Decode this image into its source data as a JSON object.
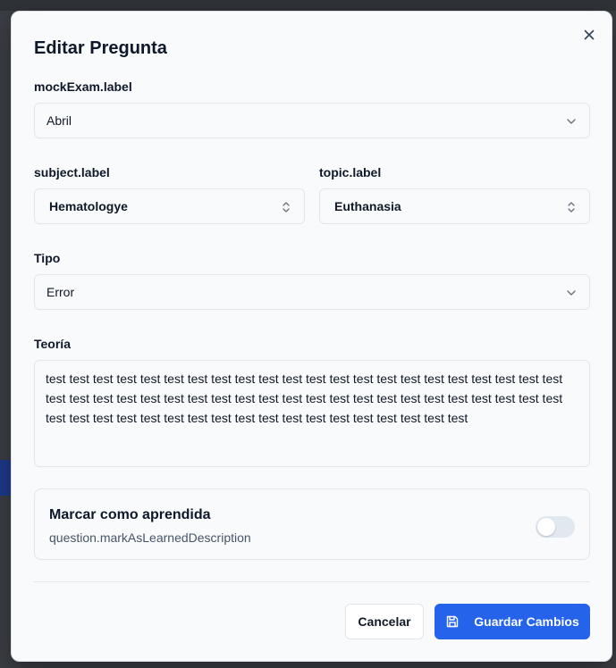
{
  "dialog": {
    "title": "Editar Pregunta",
    "close_icon": "close-icon"
  },
  "mock_exam": {
    "label": "mockExam.label",
    "value": "Abril"
  },
  "subject": {
    "label": "subject.label",
    "value": "Hematologye"
  },
  "topic": {
    "label": "topic.label",
    "value": "Euthanasia"
  },
  "type": {
    "label": "Tipo",
    "value": "Error"
  },
  "theory": {
    "label": "Teoría",
    "value": " test test test test test test test test test test test test test test test test test test test test test test test test test test test test test test test test test test test test test test test test test test test test test test test test test test test test test test test test test test test test test test"
  },
  "learned": {
    "title": "Marcar como aprendida",
    "description": "question.markAsLearnedDescription",
    "checked": false
  },
  "footer": {
    "cancel_label": "Cancelar",
    "save_label": "Guardar Cambios",
    "save_icon": "save-icon"
  },
  "colors": {
    "primary": "#2563eb",
    "backdrop": "#3b3e44",
    "surface": "#f8fafb",
    "border": "#e2e6ea"
  }
}
